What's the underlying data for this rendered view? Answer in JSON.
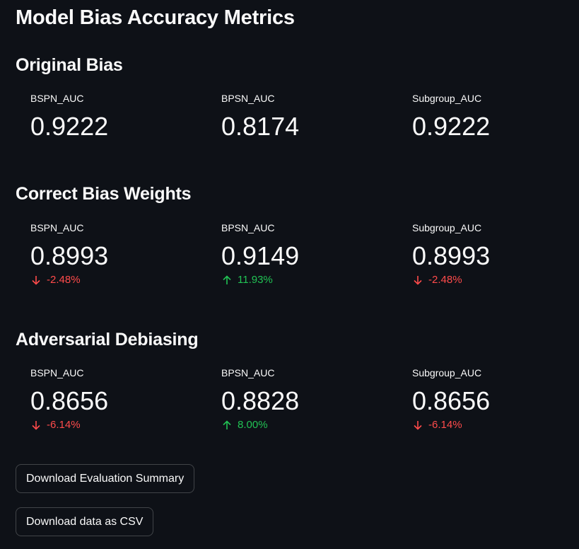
{
  "page_title": "Model Bias Accuracy Metrics",
  "colors": {
    "background": "#0e1117",
    "text": "#fafafa",
    "delta_negative": "#ff4b4b",
    "delta_positive": "#21c354"
  },
  "sections": [
    {
      "title": "Original Bias",
      "metrics": [
        {
          "label": "BSPN_AUC",
          "value": "0.9222"
        },
        {
          "label": "BPSN_AUC",
          "value": "0.8174"
        },
        {
          "label": "Subgroup_AUC",
          "value": "0.9222"
        }
      ]
    },
    {
      "title": "Correct Bias Weights",
      "metrics": [
        {
          "label": "BSPN_AUC",
          "value": "0.8993",
          "delta": "-2.48%",
          "direction": "down",
          "icon": "arrow-down-icon"
        },
        {
          "label": "BPSN_AUC",
          "value": "0.9149",
          "delta": "11.93%",
          "direction": "up",
          "icon": "arrow-up-icon"
        },
        {
          "label": "Subgroup_AUC",
          "value": "0.8993",
          "delta": "-2.48%",
          "direction": "down",
          "icon": "arrow-down-icon"
        }
      ]
    },
    {
      "title": "Adversarial Debiasing",
      "metrics": [
        {
          "label": "BSPN_AUC",
          "value": "0.8656",
          "delta": "-6.14%",
          "direction": "down",
          "icon": "arrow-down-icon"
        },
        {
          "label": "BPSN_AUC",
          "value": "0.8828",
          "delta": "8.00%",
          "direction": "up",
          "icon": "arrow-up-icon"
        },
        {
          "label": "Subgroup_AUC",
          "value": "0.8656",
          "delta": "-6.14%",
          "direction": "down",
          "icon": "arrow-down-icon"
        }
      ]
    }
  ],
  "buttons": {
    "download_summary": "Download Evaluation Summary",
    "download_csv": "Download data as CSV"
  }
}
